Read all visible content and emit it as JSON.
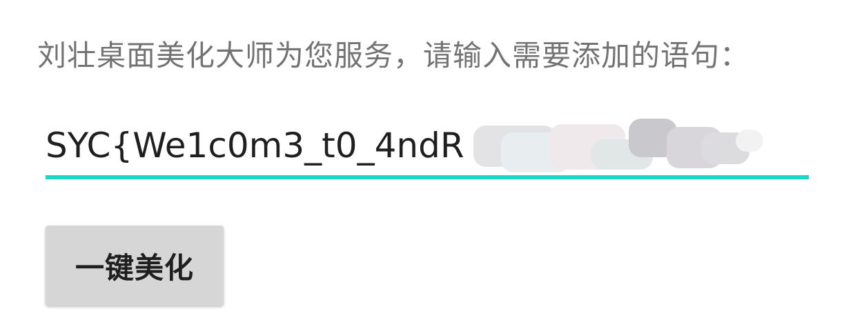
{
  "prompt": {
    "text": "刘壮桌面美化大师为您服务，请输入需要添加的语句："
  },
  "input": {
    "value": "SYC{We1c0m3_t0_4ndR",
    "closing": "}",
    "accent_color": "#1ed6c8",
    "redacted": true
  },
  "button": {
    "label": "一键美化"
  }
}
